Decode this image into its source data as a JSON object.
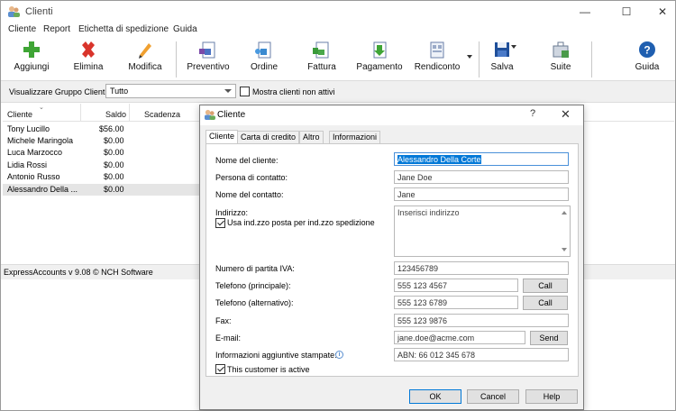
{
  "window": {
    "title": "Clienti",
    "minimize": "—",
    "maximize": "☐",
    "close": "✕"
  },
  "menu": [
    "Cliente",
    "Report",
    "Etichetta di spedizione",
    "Guida"
  ],
  "toolbar": {
    "add": "Aggiungi",
    "delete": "Elimina",
    "edit": "Modifica",
    "quote": "Preventivo",
    "order": "Ordine",
    "invoice": "Fattura",
    "payment": "Pagamento",
    "statement": "Rendiconto",
    "save": "Salva",
    "suite": "Suite",
    "help": "Guida"
  },
  "filter": {
    "label": "Visualizzare Gruppo Clienti:",
    "selected": "Tutto",
    "show_inactive": "Mostra clienti non attivi"
  },
  "list": {
    "headers": [
      "Cliente",
      "Saldo",
      "Scadenza"
    ],
    "rows": [
      {
        "name": "Tony Lucillo",
        "balance": "$56.00"
      },
      {
        "name": "Michele Maringola",
        "balance": "$0.00"
      },
      {
        "name": "Luca Marzocco",
        "balance": "$0.00"
      },
      {
        "name": "Lidia Rossi",
        "balance": "$0.00"
      },
      {
        "name": "Antonio Russo",
        "balance": "$0.00"
      },
      {
        "name": "Alessandro Della ...",
        "balance": "$0.00"
      }
    ]
  },
  "status": "ExpressAccounts v 9.08 © NCH Software",
  "dialog": {
    "title": "Cliente",
    "help": "?",
    "close": "✕",
    "tabs": [
      "Cliente",
      "Carta di credito",
      "Altro",
      "Informazioni"
    ],
    "fields": {
      "client_name_label": "Nome del cliente:",
      "client_name": "Alessandro Della Corte",
      "contact_person_label": "Persona di contatto:",
      "contact_person": "Jane Doe",
      "contact_name_label": "Nome del contatto:",
      "contact_name": "Jane",
      "address_label": "Indirizzo:",
      "address_placeholder": "Inserisci indirizzo",
      "use_address_label": "Usa ind.zzo posta per ind.zzo spedizione",
      "vat_label": "Numero di partita IVA:",
      "vat": "123456789",
      "phone_label": "Telefono (principale):",
      "phone": "555 123 4567",
      "phone_alt_label": "Telefono (alternativo):",
      "phone_alt": "555 123 6789",
      "fax_label": "Fax:",
      "fax": "555 123 9876",
      "email_label": "E-mail:",
      "email": "jane.doe@acme.com",
      "extra_info_label": "Informazioni aggiuntive stampate:",
      "extra_info": "ABN: 66 012 345 678",
      "active_label": "This customer is active"
    },
    "buttons": {
      "call": "Call",
      "send": "Send",
      "ok": "OK",
      "cancel": "Cancel",
      "help": "Help"
    }
  }
}
